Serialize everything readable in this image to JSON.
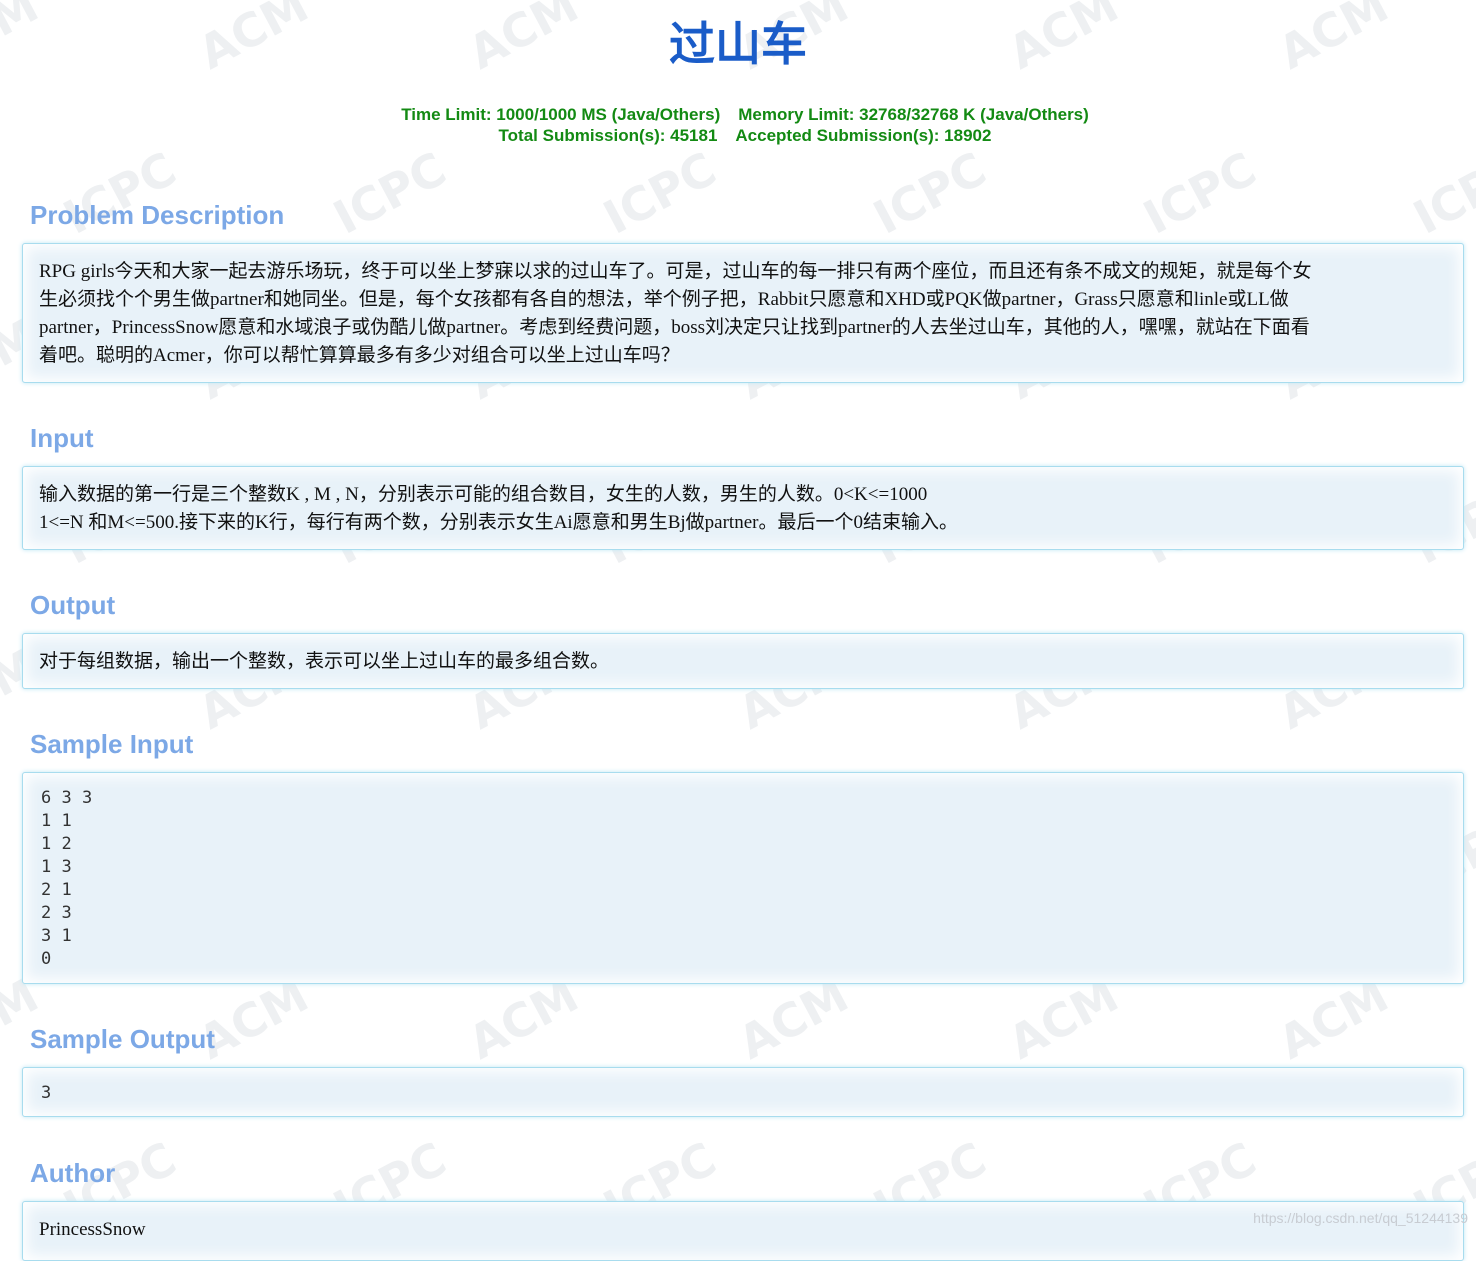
{
  "problem": {
    "title": "过山车",
    "limits": {
      "time_limit": "Time Limit: 1000/1000 MS (Java/Others)",
      "memory_limit": "Memory Limit: 32768/32768 K (Java/Others)",
      "total_submissions": "Total Submission(s): 45181",
      "accepted_submissions": "Accepted Submission(s): 18902"
    }
  },
  "sections": {
    "description": {
      "heading": "Problem Description",
      "lines": [
        "RPG girls今天和大家一起去游乐场玩，终于可以坐上梦寐以求的过山车了。可是，过山车的每一排只有两个座位，而且还有条不成文的规矩，就是每个女",
        "生必须找个个男生做partner和她同坐。但是，每个女孩都有各自的想法，举个例子把，Rabbit只愿意和XHD或PQK做partner，Grass只愿意和linle或LL做",
        "partner，PrincessSnow愿意和水域浪子或伪酷儿做partner。考虑到经费问题，boss刘决定只让找到partner的人去坐过山车，其他的人，嘿嘿，就站在下面看",
        "着吧。聪明的Acmer，你可以帮忙算算最多有多少对组合可以坐上过山车吗？"
      ]
    },
    "input": {
      "heading": "Input",
      "lines": [
        "输入数据的第一行是三个整数K , M , N，分别表示可能的组合数目，女生的人数，男生的人数。0<K<=1000",
        "1<=N 和M<=500.接下来的K行，每行有两个数，分别表示女生Ai愿意和男生Bj做partner。最后一个0结束输入。"
      ]
    },
    "output": {
      "heading": "Output",
      "lines": [
        "对于每组数据，输出一个整数，表示可以坐上过山车的最多组合数。"
      ]
    },
    "sample_input": {
      "heading": "Sample Input",
      "lines": [
        "6 3 3",
        "1 1",
        "1 2",
        "1 3",
        "2 1",
        "2 3",
        "3 1",
        "0"
      ]
    },
    "sample_output": {
      "heading": "Sample Output",
      "lines": [
        "3"
      ]
    },
    "author": {
      "heading": "Author",
      "lines": [
        "PrincessSnow"
      ]
    }
  },
  "watermark": {
    "acm": "ACM",
    "icpc": "ICPC",
    "url": "https://blog.csdn.net/qq_51244139"
  },
  "colors": {
    "title": "#1a5cc8",
    "limits": "#138a13",
    "heading": "#7ca8e6",
    "panel_bg": "#e8f2f9",
    "panel_border": "#a8dcee"
  }
}
